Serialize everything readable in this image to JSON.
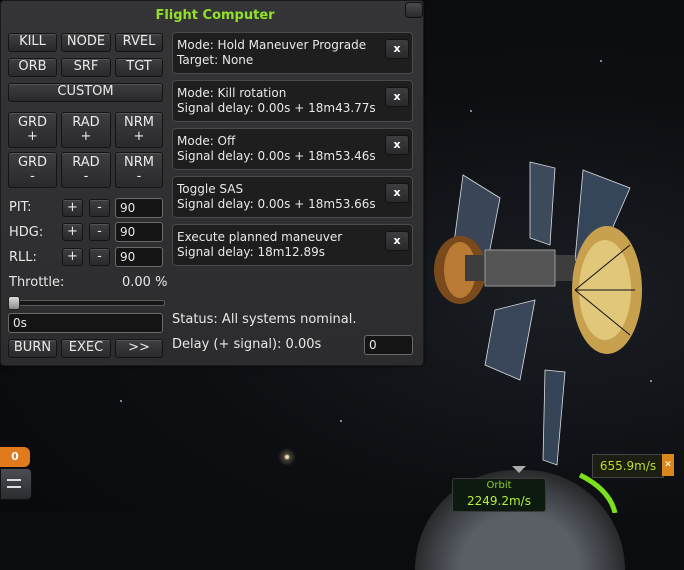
{
  "window": {
    "title": "Flight Computer"
  },
  "attitude_buttons": {
    "row1": [
      "KILL",
      "NODE",
      "RVEL"
    ],
    "row2": [
      "ORB",
      "SRF",
      "TGT"
    ],
    "custom": "CUSTOM",
    "plus_row": [
      {
        "name": "GRD",
        "sign": "+"
      },
      {
        "name": "RAD",
        "sign": "+"
      },
      {
        "name": "NRM",
        "sign": "+"
      }
    ],
    "minus_row": [
      {
        "name": "GRD",
        "sign": "-"
      },
      {
        "name": "RAD",
        "sign": "-"
      },
      {
        "name": "NRM",
        "sign": "-"
      }
    ]
  },
  "axes": [
    {
      "label": "PIT:",
      "plus": "+",
      "minus": "-",
      "value": "90"
    },
    {
      "label": "HDG:",
      "plus": "+",
      "minus": "-",
      "value": "90"
    },
    {
      "label": "RLL:",
      "plus": "+",
      "minus": "-",
      "value": "90"
    }
  ],
  "throttle": {
    "label": "Throttle:",
    "value": "0.00 %",
    "fraction": 0.0
  },
  "burn_time": "0s",
  "actions": {
    "burn": "BURN",
    "exec": "EXEC",
    "next": ">>"
  },
  "queue": [
    {
      "line1": "Mode: Hold Maneuver Prograde",
      "line2": "Target: None",
      "remove": "x"
    },
    {
      "line1": "Mode: Kill rotation",
      "line2": "Signal delay: 0.00s + 18m43.77s",
      "remove": "x"
    },
    {
      "line1": "Mode: Off",
      "line2": "Signal delay: 0.00s + 18m53.46s",
      "remove": "x"
    },
    {
      "line1": "Toggle SAS",
      "line2": "Signal delay: 0.00s + 18m53.66s",
      "remove": "x"
    },
    {
      "line1": "Execute planned maneuver",
      "line2": "Signal delay: 18m12.89s",
      "remove": "x"
    }
  ],
  "status": "Status: All systems nominal.",
  "delay": {
    "label": "Delay (+ signal): 0.00s",
    "value": "0"
  },
  "hud": {
    "stage_count": "0",
    "vertical_speed": "655.9m/s",
    "nav_mode": "Orbit",
    "orbit_velocity": "2249.2m/s"
  }
}
